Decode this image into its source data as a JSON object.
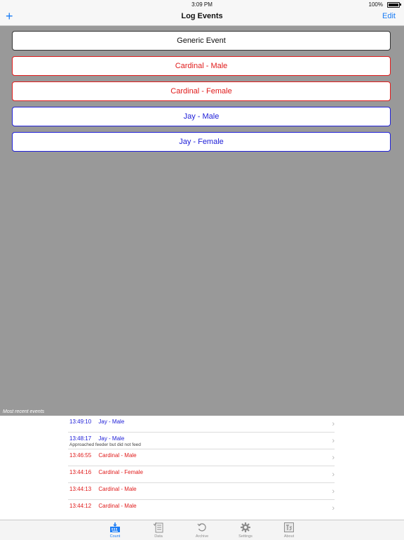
{
  "status_bar": {
    "time": "3:09 PM",
    "battery": "100%"
  },
  "nav": {
    "add_label": "+",
    "title": "Log Events",
    "edit_label": "Edit"
  },
  "event_buttons": [
    {
      "label": "Generic Event",
      "color": "#111111"
    },
    {
      "label": "Cardinal - Male",
      "color": "#e01b1b"
    },
    {
      "label": "Cardinal - Female",
      "color": "#e01b1b"
    },
    {
      "label": "Jay - Male",
      "color": "#2020d8"
    },
    {
      "label": "Jay - Female",
      "color": "#2020d8"
    }
  ],
  "recent": {
    "label": "Most recent events",
    "events": [
      {
        "time": "13:49:10",
        "name": "Jay - Male",
        "note": "",
        "color": "#2020d8"
      },
      {
        "time": "13:48:17",
        "name": "Jay - Male",
        "note": "Approached feeder but did not feed",
        "color": "#2020d8"
      },
      {
        "time": "13:46:55",
        "name": "Cardinal - Male",
        "note": "",
        "color": "#e01b1b"
      },
      {
        "time": "13:44:16",
        "name": "Cardinal - Female",
        "note": "",
        "color": "#e01b1b"
      },
      {
        "time": "13:44:13",
        "name": "Cardinal - Male",
        "note": "",
        "color": "#e01b1b"
      },
      {
        "time": "13:44:12",
        "name": "Cardinal - Male",
        "note": "",
        "color": "#e01b1b"
      }
    ]
  },
  "tabs": [
    {
      "label": "Count",
      "icon": "count-icon",
      "active": true
    },
    {
      "label": "Data",
      "icon": "data-icon",
      "active": false
    },
    {
      "label": "Archive",
      "icon": "archive-icon",
      "active": false
    },
    {
      "label": "Settings",
      "icon": "settings-gear-icon",
      "active": false
    },
    {
      "label": "About",
      "icon": "about-ts-icon",
      "active": false
    }
  ],
  "accent_color": "#1a7cf5"
}
